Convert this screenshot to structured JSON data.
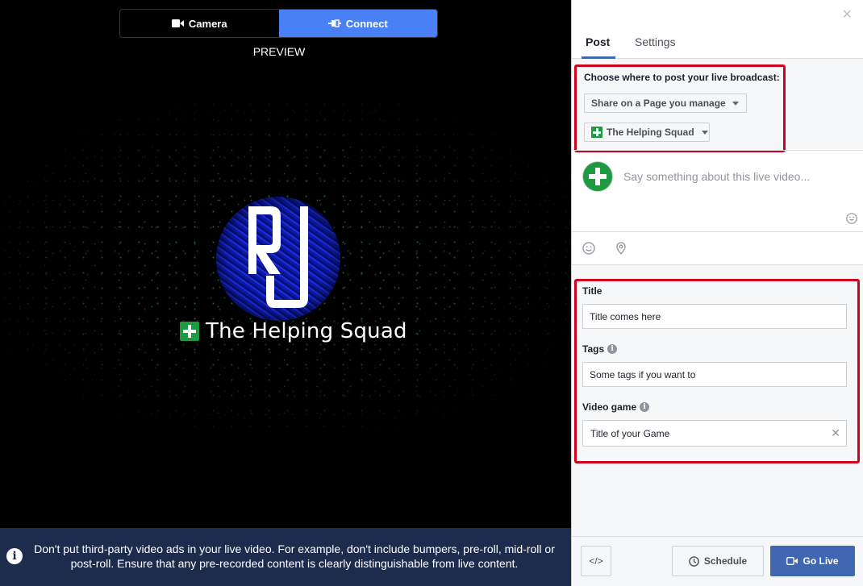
{
  "preview": {
    "mode_tabs": [
      {
        "label": "Camera",
        "icon": "video-camera-icon",
        "active": false
      },
      {
        "label": "Connect",
        "icon": "connect-icon",
        "active": true
      }
    ],
    "label": "PREVIEW",
    "brand_name": "The Helping Squad",
    "logo_text": "RJ"
  },
  "notice": {
    "text": "Don't put third-party video ads in your live video. For example, don't include bumpers, pre-roll, mid-roll or post-roll. Ensure that any pre-recorded content is clearly distinguishable from live content.",
    "icon": "info-icon"
  },
  "panel": {
    "close_icon": "close-icon",
    "tabs": [
      {
        "label": "Post",
        "active": true
      },
      {
        "label": "Settings",
        "active": false
      }
    ],
    "destination": {
      "label": "Choose where to post your live broadcast:",
      "share_option": "Share on a Page you manage",
      "page_option": "The Helping Squad"
    },
    "compose": {
      "placeholder": "Say something about this live video..."
    },
    "fields": {
      "title": {
        "label": "Title",
        "value": "Title comes here"
      },
      "tags": {
        "label": "Tags",
        "value": "Some tags if you want to"
      },
      "video_game": {
        "label": "Video game",
        "value": "Title of your Game"
      }
    },
    "footer": {
      "embed_label": "</>",
      "schedule_label": "Schedule",
      "golive_label": "Go Live"
    }
  },
  "colors": {
    "accent_blue": "#4267b2",
    "connect_blue": "#4a80f5",
    "highlight_red": "#d0021b",
    "brand_green": "#1e9a41",
    "notice_bg": "#1d2b4d"
  }
}
